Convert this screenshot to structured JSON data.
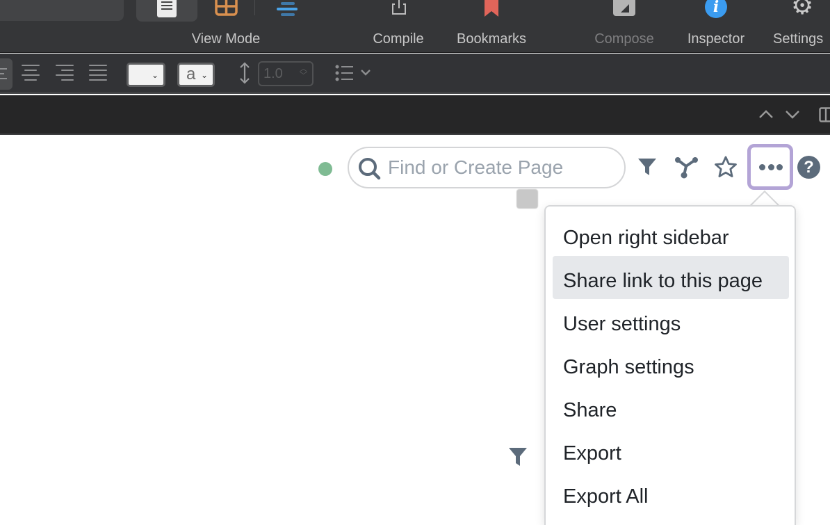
{
  "toolbar": {
    "items": [
      {
        "label": "View Mode",
        "icon": "view-mode-icons",
        "disabled": false
      },
      {
        "label": "Compile",
        "icon": "share-box-icon",
        "disabled": false
      },
      {
        "label": "Bookmarks",
        "icon": "bookmark-icon",
        "disabled": false
      },
      {
        "label": "Compose",
        "icon": "compose-icon",
        "disabled": true
      },
      {
        "label": "Inspector",
        "icon": "info-icon",
        "disabled": false
      },
      {
        "label": "Settings",
        "icon": "gear-icon",
        "disabled": false
      }
    ],
    "colors": {
      "grid_icon": "#d9904f",
      "outline_icon": "#4aa3e8",
      "bookmark": "#e1655a",
      "info": "#3b9cf0"
    }
  },
  "formatbar": {
    "alignments": [
      "align-left",
      "align-center",
      "align-right",
      "align-justify"
    ],
    "style_popup_value": "",
    "text_color_popup_value": "a",
    "line_spacing_value": "1.0"
  },
  "findbar": {
    "prev_icon": "chevron-up-icon",
    "next_icon": "chevron-down-icon"
  },
  "content": {
    "sync_status_color": "#7fbb93",
    "search": {
      "placeholder": "Find or Create Page",
      "value": ""
    },
    "toolbar_icons": [
      "filter-icon",
      "graph-icon",
      "star-icon",
      "more-icon",
      "help-icon"
    ],
    "menu": {
      "items": [
        {
          "label": "Open right sidebar",
          "active": false
        },
        {
          "label": "Share link to this page",
          "active": true
        },
        {
          "label": "User settings",
          "active": false
        },
        {
          "label": "Graph settings",
          "active": false
        },
        {
          "label": "Share",
          "active": false
        },
        {
          "label": "Export",
          "active": false
        },
        {
          "label": "Export All",
          "active": false
        }
      ]
    }
  }
}
